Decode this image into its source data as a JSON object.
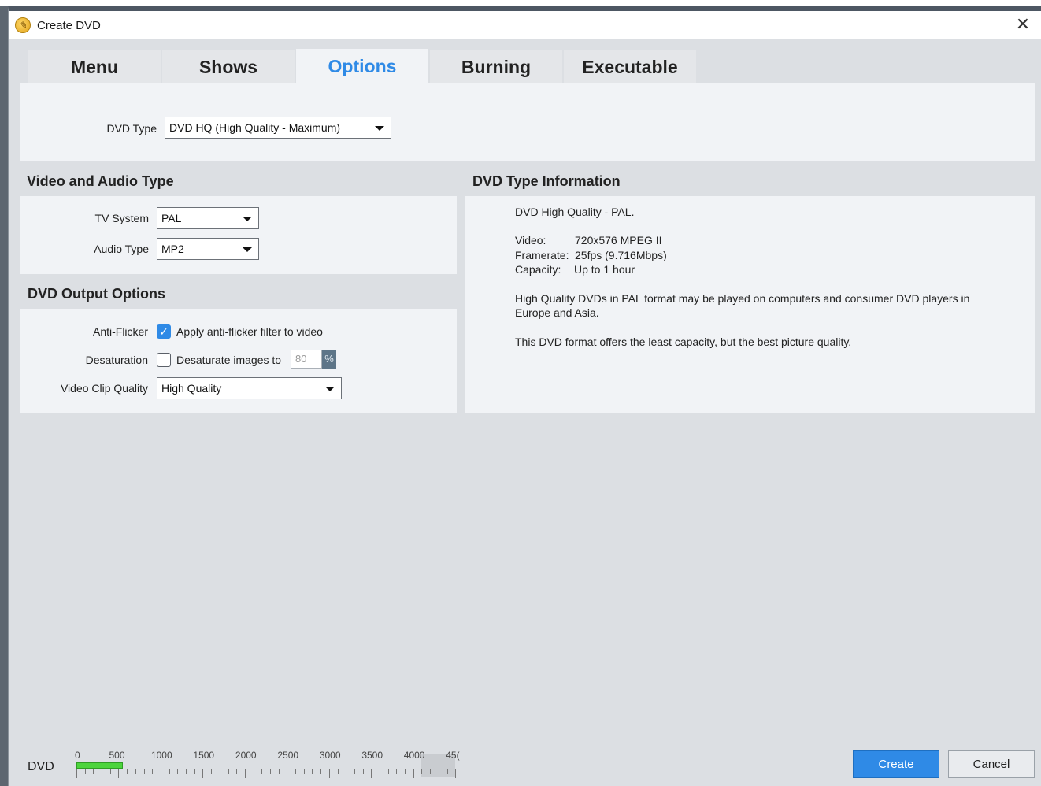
{
  "window": {
    "title": "Create DVD",
    "close_glyph": "✕"
  },
  "tabs": [
    {
      "label": "Menu",
      "active": false
    },
    {
      "label": "Shows",
      "active": false
    },
    {
      "label": "Options",
      "active": true
    },
    {
      "label": "Burning",
      "active": false
    },
    {
      "label": "Executable",
      "active": false
    }
  ],
  "dvd_type": {
    "label": "DVD Type",
    "value": "DVD HQ (High Quality - Maximum)"
  },
  "video_audio": {
    "title": "Video and Audio Type",
    "tv_system_label": "TV System",
    "tv_system_value": "PAL",
    "audio_type_label": "Audio Type",
    "audio_type_value": "MP2"
  },
  "output_options": {
    "title": "DVD Output Options",
    "anti_flicker_label": "Anti-Flicker",
    "anti_flicker_text": "Apply anti-flicker filter to video",
    "anti_flicker_checked": true,
    "desaturation_label": "Desaturation",
    "desaturation_text": "Desaturate images to",
    "desaturation_checked": false,
    "desaturation_value": "80",
    "desaturation_unit": "%",
    "clip_quality_label": "Video Clip Quality",
    "clip_quality_value": "High Quality"
  },
  "type_info": {
    "title": "DVD Type Information",
    "headline": "DVD High Quality - PAL.",
    "video_key": "Video:",
    "video_val": "720x576 MPEG II",
    "framerate_key": "Framerate:",
    "framerate_val": "25fps (9.716Mbps)",
    "capacity_key": "Capacity:",
    "capacity_val": "Up to 1 hour",
    "para1_line1": "High Quality DVDs in PAL format may be played on computers and consumer DVD players in",
    "para1_line2": "Europe and Asia.",
    "para2": "This DVD format offers the least capacity, but the best picture quality."
  },
  "capacity_bar": {
    "label": "DVD",
    "ticks": [
      "0",
      "500",
      "1000",
      "1500",
      "2000",
      "2500",
      "3000",
      "3500",
      "4000",
      "45("
    ],
    "fill_value": 550,
    "max_value": 4500
  },
  "buttons": {
    "create": "Create",
    "cancel": "Cancel"
  },
  "colors": {
    "accent": "#2f8ae6",
    "fill": "#4cd43c"
  }
}
